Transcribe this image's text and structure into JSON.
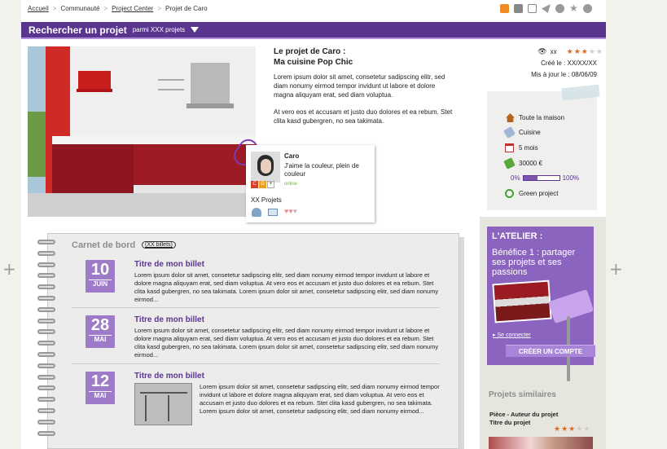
{
  "breadcrumb": {
    "home": "Accueil",
    "community": "Communauté",
    "project_center": "Project Center",
    "current": "Projet de Caro"
  },
  "toolbar_icons": [
    "rss-icon",
    "print-icon",
    "mail-icon",
    "share-icon",
    "info-circle-icon",
    "star-icon",
    "alert-icon"
  ],
  "search_bar": {
    "title": "Rechercher un projet",
    "subtitle": "parmi XXX projets"
  },
  "project": {
    "title_line1": "Le projet de Caro :",
    "title_line2": "Ma cuisine Pop Chic",
    "paragraph1": "Lorem ipsum dolor sit amet, consetetur sadipscing elitr, sed diam nonumy eirmod tempor invidunt ut labore et dolore magna aliquyam erat, sed diam voluptua.",
    "paragraph2": "At vero eos et accusam et justo duo dolores et ea rebum. Stet clita kasd gubergren, no sea takimata."
  },
  "meta": {
    "views": "xx",
    "rating": 3,
    "rating_max": 5,
    "created": "Créé le : XX/XX/XX",
    "updated": "Mis à jour le : 08/06/09"
  },
  "details": {
    "scope": "Toute la maison",
    "room": "Cuisine",
    "duration": "5 mois",
    "budget": "30000 €",
    "progress_start": "0%",
    "progress_end": "100%",
    "progress_fraction": 0.4,
    "green": "Green project"
  },
  "profile": {
    "name": "Caro",
    "bio": "J'aime la couleur, plein de couleur",
    "status": "online",
    "projects": "XX Projets",
    "badges": [
      "C",
      "D",
      "+"
    ]
  },
  "notebook": {
    "title": "Carnet de bord",
    "count": "(XX billets)",
    "entries": [
      {
        "day": "10",
        "month": "JUIN",
        "title": "Titre de mon billet",
        "text": "Lorem ipsum dolor sit amet, consetetur sadipscing elitr, sed diam nonumy eirmod tempor invidunt ut labore et dolore magna aliquyam erat, sed diam voluptua. At vero eos et accusam et justo duo dolores et ea rebum. Stet clita kasd gubergren, no sea takimata. Lorem ipsum dolor sit amet, consetetur sadipscing elitr, sed diam nonumy eirmod..."
      },
      {
        "day": "28",
        "month": "MAI",
        "title": "Titre de mon billet",
        "text": "Lorem ipsum dolor sit amet, consetetur sadipscing elitr, sed diam nonumy eirmod tempor invidunt ut labore et dolore magna aliquyam erat, sed diam voluptua. At vero eos et accusam et justo duo dolores et ea rebum. Stet clita kasd gubergren, no sea takimata. Lorem ipsum dolor sit amet, consetetur sadipscing elitr, sed diam nonumy eirmod..."
      },
      {
        "day": "12",
        "month": "MAI",
        "title": "Titre de mon billet",
        "text": "Lorem ipsum dolor sit amet, consetetur sadipscing elitr, sed diam nonumy eirmod tempor invidunt ut labore et dolore magna aliquyam erat, sed diam voluptua. At vero eos et accusam et justo duo dolores et ea rebum. Stet clita kasd gubergren, no sea takimata. Lorem ipsum dolor sit amet, consetetur sadipscing elitr, sed diam nonumy eirmod..."
      }
    ]
  },
  "atelier": {
    "heading": "L'ATELIER :",
    "body": "Bénéfice 1 : partager ses projets et ses passions",
    "login": "Se connecter",
    "cta": "CRÉER UN COMPTE"
  },
  "similar": {
    "title": "Projets similaires",
    "caption1": "Pièce - Auteur du projet",
    "caption2": "Titre du projet",
    "rating": 3,
    "rating_max": 5
  },
  "colors": {
    "primary": "#5a3590",
    "accent": "#9d7bc8",
    "rating": "#e06a1c",
    "online": "#6cb33f"
  }
}
